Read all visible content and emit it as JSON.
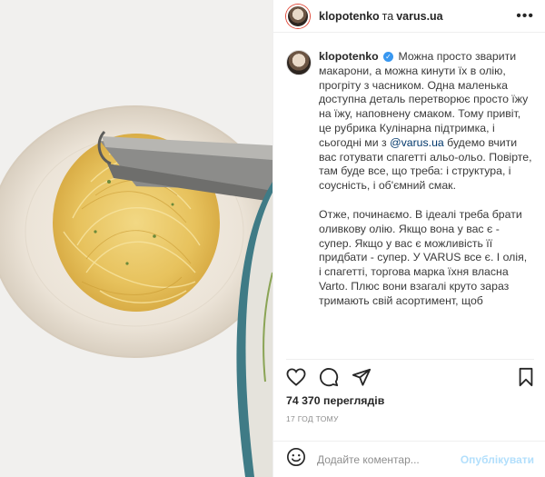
{
  "header": {
    "author": "klopotenko",
    "connector": "та",
    "partner": "varus.ua",
    "more_label": "•••"
  },
  "caption": {
    "author": "klopotenko",
    "verified_glyph": "✓",
    "p1_before": "Можна просто зварити макарони, а можна кинути їх в олію, прогріту з часником. Одна маленька доступна деталь перетворює просто їжу на їжу, наповнену смаком. Тому привіт, це рубрика Кулінарна підтримка, і сьогодні ми з ",
    "mention": "@varus.ua",
    "p1_after": " будемо вчити вас готувати спагетті альо-ольо. Повірте, там буде все, що треба: і структура, і соусність, і об'ємний смак.",
    "p2": "Отже, починаємо. В ідеалі треба брати оливкову олію. Якщо вона у вас є - супер. Якщо у вас є можливість її придбати - супер. У VARUS все є. І олія, і спагетті, торгова марка їхня власна Varto. Плюс вони взагалі круто зараз тримають свій асортимент, щоб"
  },
  "actions": {
    "icons": [
      "heart-icon",
      "comment-icon",
      "share-icon",
      "bookmark-icon"
    ]
  },
  "stats": {
    "views_count": "74 370",
    "views_label": "переглядів",
    "time_ago": "17 ГОД ТОМУ"
  },
  "comment": {
    "emoji_icon": "smile-icon",
    "placeholder": "Додайте коментар...",
    "publish_label": "Опублікувати"
  },
  "colors": {
    "link": "#00376b",
    "verified": "#3897f0",
    "publish": "#b2dffc",
    "muted": "#8e8e8e"
  }
}
